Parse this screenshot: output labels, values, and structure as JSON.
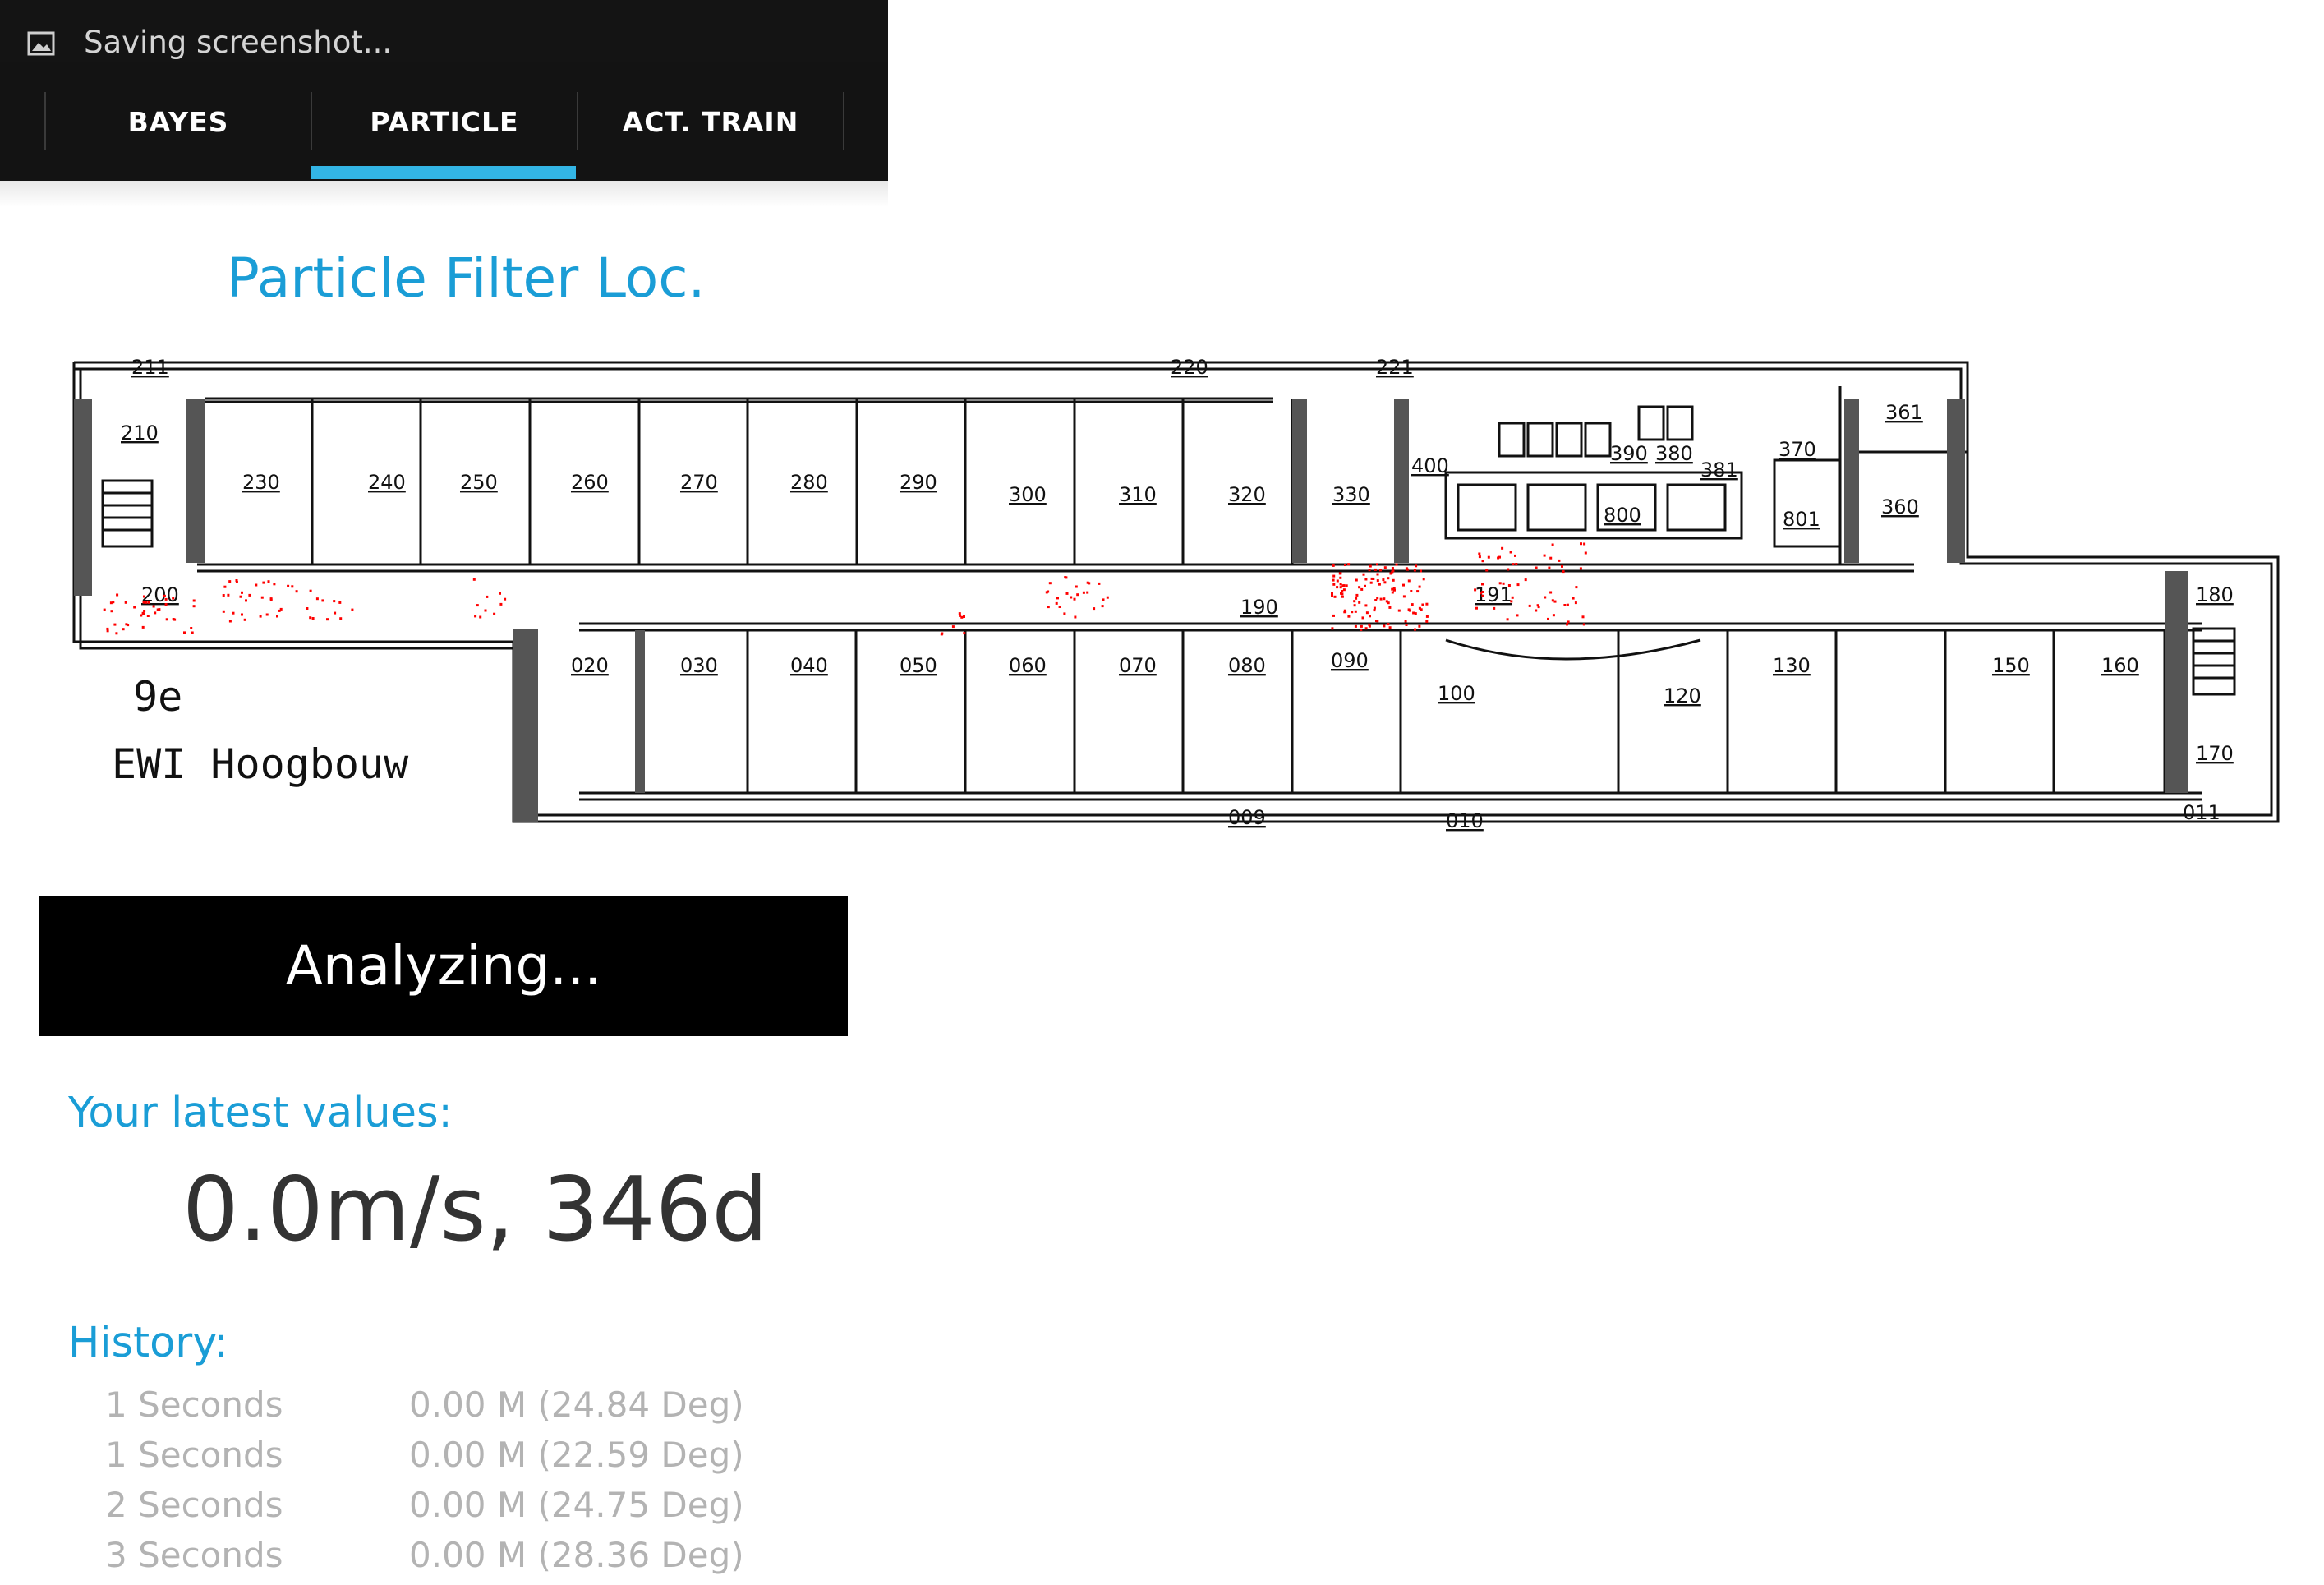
{
  "status_bar": {
    "notification_text": "Saving screenshot..."
  },
  "tabs": [
    {
      "label": "BAYES",
      "selected": false
    },
    {
      "label": "PARTICLE",
      "selected": true
    },
    {
      "label": "ACT. TRAIN",
      "selected": false
    }
  ],
  "accent_color": "#33b5e5",
  "title": "Particle Filter Loc.",
  "floorplan": {
    "building_floor": "9e",
    "building_name": "EWI  Hoogbouw",
    "room_labels": [
      "210",
      "230",
      "240",
      "250",
      "260",
      "270",
      "280",
      "290",
      "300",
      "310",
      "320",
      "330",
      "400",
      "390",
      "380",
      "381",
      "370",
      "361",
      "360",
      "800",
      "801",
      "200",
      "190",
      "191",
      "180",
      "170",
      "020",
      "030",
      "040",
      "050",
      "060",
      "070",
      "080",
      "090",
      "100",
      "120",
      "130",
      "150",
      "160",
      "009",
      "010",
      "011",
      "220",
      "221",
      "211"
    ],
    "particle_color": "#ff0000"
  },
  "analyze_button": {
    "label": "Analyzing..."
  },
  "latest": {
    "label": "Your latest values:",
    "value": "0.0m/s, 346d"
  },
  "history": {
    "label": "History:",
    "items": [
      {
        "time": "1 Seconds",
        "value": "0.00 M (24.84 Deg)"
      },
      {
        "time": "1 Seconds",
        "value": "0.00 M (22.59 Deg)"
      },
      {
        "time": "2 Seconds",
        "value": "0.00 M (24.75 Deg)"
      },
      {
        "time": "3 Seconds",
        "value": "0.00 M (28.36 Deg)"
      }
    ]
  }
}
